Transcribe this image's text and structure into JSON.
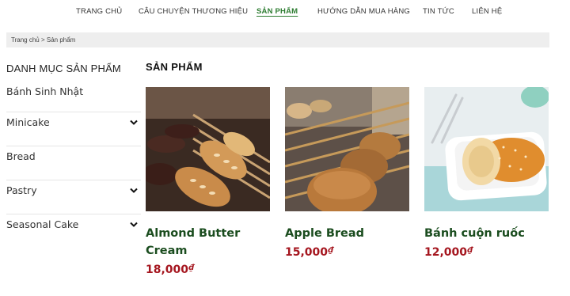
{
  "nav": {
    "items": [
      {
        "label": "TRANG CHỦ",
        "active": false
      },
      {
        "label": "CÂU CHUYỆN THƯƠNG HIỆU",
        "active": false
      },
      {
        "label": "SẢN PHẨM",
        "active": true
      },
      {
        "label": "HƯỚNG DẪN MUA HÀNG",
        "active": false
      },
      {
        "label": "TIN TỨC",
        "active": false
      },
      {
        "label": "LIÊN HỆ",
        "active": false
      }
    ]
  },
  "breadcrumb": {
    "home": "Trang chủ",
    "separator": ">",
    "current": "Sản phẩm"
  },
  "sidebar": {
    "heading": "DANH MỤC SẢN PHẨM",
    "items": [
      {
        "label": "Bánh Sinh Nhật",
        "expandable": false
      },
      {
        "label": "Minicake",
        "expandable": true,
        "icon": "chevron-down-icon"
      },
      {
        "label": "Bread",
        "expandable": false
      },
      {
        "label": "Pastry",
        "expandable": true,
        "icon": "chevron-down-icon"
      },
      {
        "label": "Seasonal Cake",
        "expandable": true,
        "icon": "chevron-down-icon"
      }
    ]
  },
  "products": {
    "title": "SẢN PHẨM",
    "items": [
      {
        "name": "Almond Butter Cream",
        "price": "18,000",
        "currency": "₫"
      },
      {
        "name": "Apple Bread",
        "price": "15,000",
        "currency": "₫"
      },
      {
        "name": "Bánh cuộn ruốc",
        "price": "12,000",
        "currency": "₫"
      }
    ]
  },
  "colors": {
    "accent": "#2e7d32",
    "product_name": "#1b4d1f",
    "price": "#a5161f",
    "breadcrumb_bg": "#eeeeee"
  }
}
